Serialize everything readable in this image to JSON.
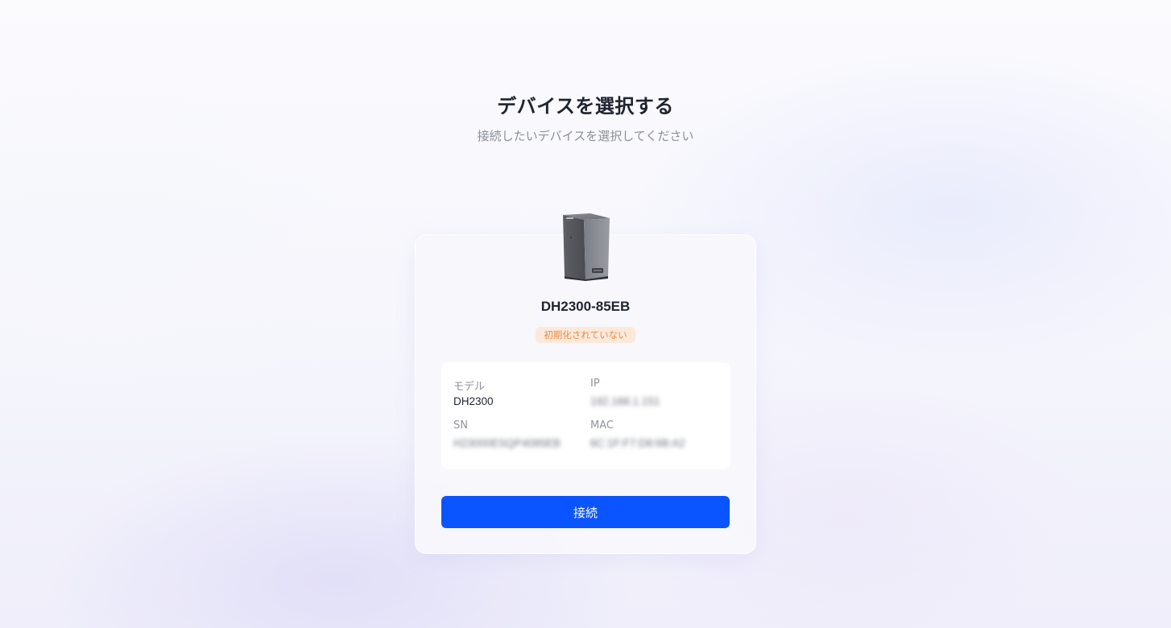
{
  "header": {
    "title": "デバイスを選択する",
    "subtitle": "接続したいデバイスを選択してください"
  },
  "device": {
    "image_icon": "nas-device-icon",
    "name": "DH2300-85EB",
    "status": "初期化されていない",
    "status_color": "#f08a3e",
    "info": {
      "model_label": "モデル",
      "model_value": "DH2300",
      "ip_label": "IP",
      "ip_value": "192.168.1.151",
      "sn_label": "SN",
      "sn_value": "H23000ESQP4085EB",
      "mac_label": "MAC",
      "mac_value": "6C:1F:F7:D8:6B:A2"
    }
  },
  "actions": {
    "connect_label": "接続",
    "connect_color": "#0a55ff"
  }
}
